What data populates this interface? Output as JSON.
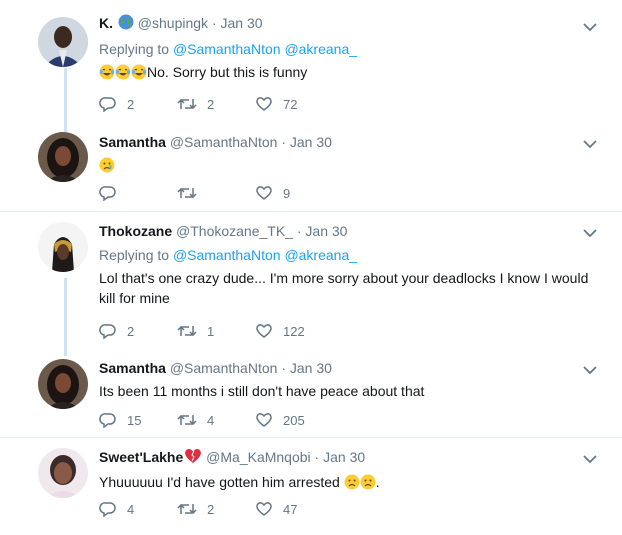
{
  "tweets": [
    {
      "name": "K.",
      "handle": "@shupingk",
      "dot": "·",
      "date": "Jan 30",
      "replying_label": "Replying to",
      "replying_to": [
        "@SamanthaNton",
        "@akreana_"
      ],
      "text": "No. Sorry but this is funny",
      "emoji_prefix": [
        "laugh-cry",
        "laugh-cry",
        "laugh-cry"
      ],
      "replies": "2",
      "retweets": "2",
      "likes": "72"
    },
    {
      "name": "Samantha",
      "handle": "@SamanthaNton",
      "dot": "·",
      "date": "Jan 30",
      "text": "",
      "emoji_prefix": [
        "crying-face"
      ],
      "replies": "",
      "retweets": "",
      "likes": "9"
    },
    {
      "name": "Thokozane",
      "handle": "@Thokozane_TK_",
      "dot": "·",
      "date": "Jan 30",
      "replying_label": "Replying to",
      "replying_to": [
        "@SamanthaNton",
        "@akreana_"
      ],
      "text_line1": "Lol that's one crazy dude... I'm more sorry about your deadlocks I know I would",
      "text_line2": "kill for mine",
      "replies": "2",
      "retweets": "1",
      "likes": "122"
    },
    {
      "name": "Samantha",
      "handle": "@SamanthaNton",
      "dot": "·",
      "date": "Jan 30",
      "text": "Its been 11 months i still don't have peace about that",
      "replies": "15",
      "retweets": "4",
      "likes": "205"
    },
    {
      "name": "Sweet'Lakhe",
      "name_emoji": "heart-icon",
      "handle": "@Ma_KaMnqobi",
      "dot": "·",
      "date": "Jan 30",
      "text": "Yhuuuuuu I'd have gotten him arrested",
      "text_suffix": ".",
      "emoji_suffix": [
        "frown-face",
        "frown-face"
      ],
      "replies": "4",
      "retweets": "2",
      "likes": "47"
    }
  ],
  "colors": {
    "link": "#1da1f2",
    "muted": "#657786",
    "thread": "#cde3f3",
    "divider": "#e6ecf0"
  }
}
